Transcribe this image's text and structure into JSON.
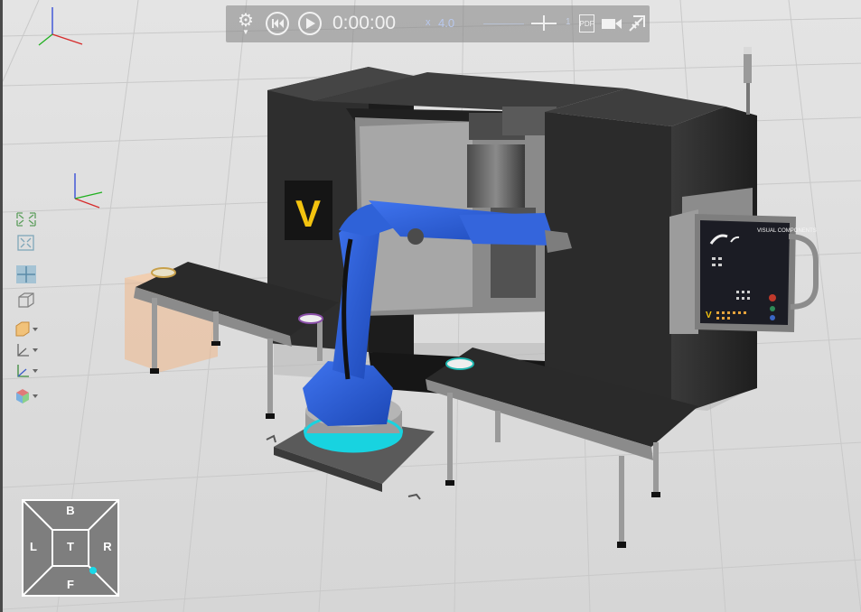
{
  "playback": {
    "time": "0:00:00",
    "speed_prefix": "x",
    "speed_value": "4.0",
    "slider_end": "1",
    "pdf_label": "PDF"
  },
  "left_toolbar": {
    "icons": [
      "fit-all-icon",
      "fit-selection-icon",
      "snap-view-icon",
      "box-view-icon",
      "render-mode-icon",
      "axes-icon",
      "frame-icon",
      "color-cube-icon"
    ]
  },
  "nav_cube": {
    "top": "B",
    "left": "L",
    "center": "T",
    "right": "R",
    "bottom": "F"
  },
  "machine": {
    "logo_letter": "V",
    "panel_brand": "VISUAL COMPONENTS"
  },
  "colors": {
    "floor": "#dcdcdc",
    "robot": "#2d5fd6",
    "machine": "#2a2a2a",
    "accent_cyan": "#19d9e8"
  }
}
